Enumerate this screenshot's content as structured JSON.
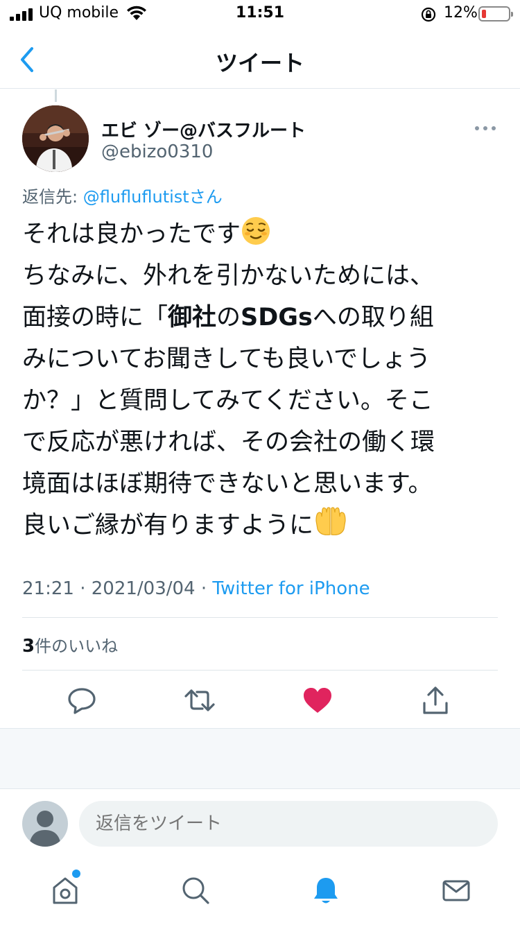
{
  "status_bar": {
    "carrier": "UQ mobile",
    "time": "11:51",
    "battery": "12%",
    "battery_level": 0.12
  },
  "nav": {
    "title": "ツイート",
    "back_icon": "chevron-left-icon"
  },
  "tweet": {
    "display_name": "エビ ゾー@バスフルート",
    "handle": "@ebizo0310",
    "reply_prefix": "返信先: ",
    "reply_mention": "@flufluflutist",
    "reply_suffix": "さん",
    "lines": {
      "l1": "それは良かったです",
      "l2": "ちなみに、外れを引かないためには、",
      "l3a": "面接の時に「",
      "l3b": "御社",
      "l3c": "の",
      "l3d": "SDGs",
      "l3e": "への取り組",
      "l4": "みについてお聞きしても良いでしょう",
      "l5": "か？」と質問してみてください。そこ",
      "l6": "で反応が悪ければ、その会社の働く環",
      "l7": "境面はほぼ期待できないと思います。",
      "l8": "良いご縁が有りますように"
    },
    "emojis": [
      "relieved-face-icon",
      "palms-up-together-icon"
    ],
    "time": "21:21",
    "date": "2021/03/04",
    "source": "Twitter for iPhone",
    "likes_count": "3",
    "likes_label": "件のいいね"
  },
  "actions": [
    "reply-icon",
    "retweet-icon",
    "like-icon",
    "share-icon"
  ],
  "reply_box": {
    "placeholder": "返信をツイート"
  },
  "tabbar": [
    "home-icon",
    "search-icon",
    "notifications-icon",
    "messages-icon"
  ],
  "colors": {
    "accent": "#1d9bf0",
    "like": "#e0245e",
    "text": "#0f1419",
    "secondary": "#536471"
  }
}
